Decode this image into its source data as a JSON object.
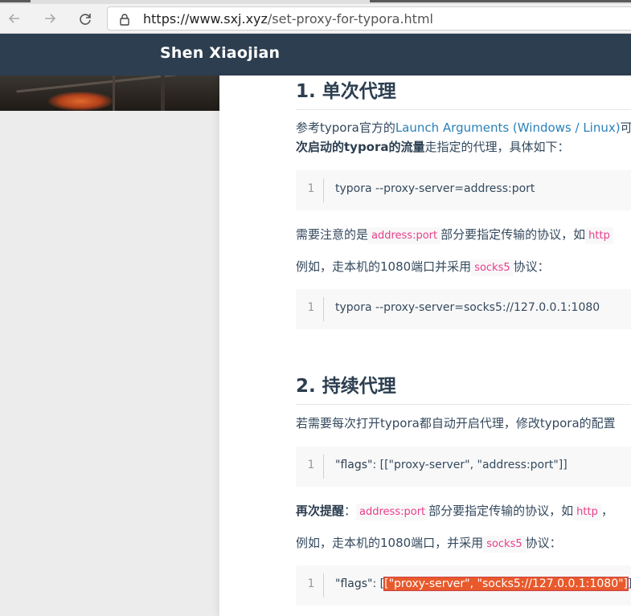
{
  "browser": {
    "url_host": "https://www.sxj.xyz",
    "url_path": "/set-proxy-for-typora.html"
  },
  "site": {
    "name": "Shen Xiaojian"
  },
  "article": {
    "section1": {
      "heading": "1. 单次代理",
      "para1_a": "参考typora官方的",
      "para1_link": "Launch Arguments (Windows / Linux)",
      "para1_b": "可",
      "para1_bold": "次启动的typora的流量",
      "para1_c": "走指定的代理，具体如下：",
      "code1_line": "1",
      "code1": "typora --proxy-server=address:port",
      "para2_a": "需要注意的是",
      "para2_code": "address:port",
      "para2_b": "部分要指定传输的协议，如",
      "para2_code2": "http",
      "para3_a": "例如，走本机的1080端口并采用",
      "para3_code": "socks5",
      "para3_b": "协议：",
      "code2_line": "1",
      "code2": "typora --proxy-server=socks5://127.0.0.1:1080"
    },
    "section2": {
      "heading": "2. 持续代理",
      "para1": "若需要每次打开typora都自动开启代理，修改typora的配置",
      "code1_line": "1",
      "code1_key": "\"flags\"",
      "code1_rest": ": [[\"proxy-server\", \"address:port\"]]",
      "para2_bold": "再次提醒",
      "para2_colon": "：",
      "para2_code": "address:port",
      "para2_b": "部分要指定传输的协议，如",
      "para2_code2": "http",
      "para2_c": "，",
      "para3_a": "例如，走本机的1080端口，并采用",
      "para3_code": "socks5",
      "para3_b": "协议：",
      "code2_line": "1",
      "code2_key": "\"flags\"",
      "code2_pre": ": [",
      "code2_sel": "[\"proxy-server\", \"socks5://127.0.0.1:1080\"]",
      "code2_post": "]"
    }
  }
}
